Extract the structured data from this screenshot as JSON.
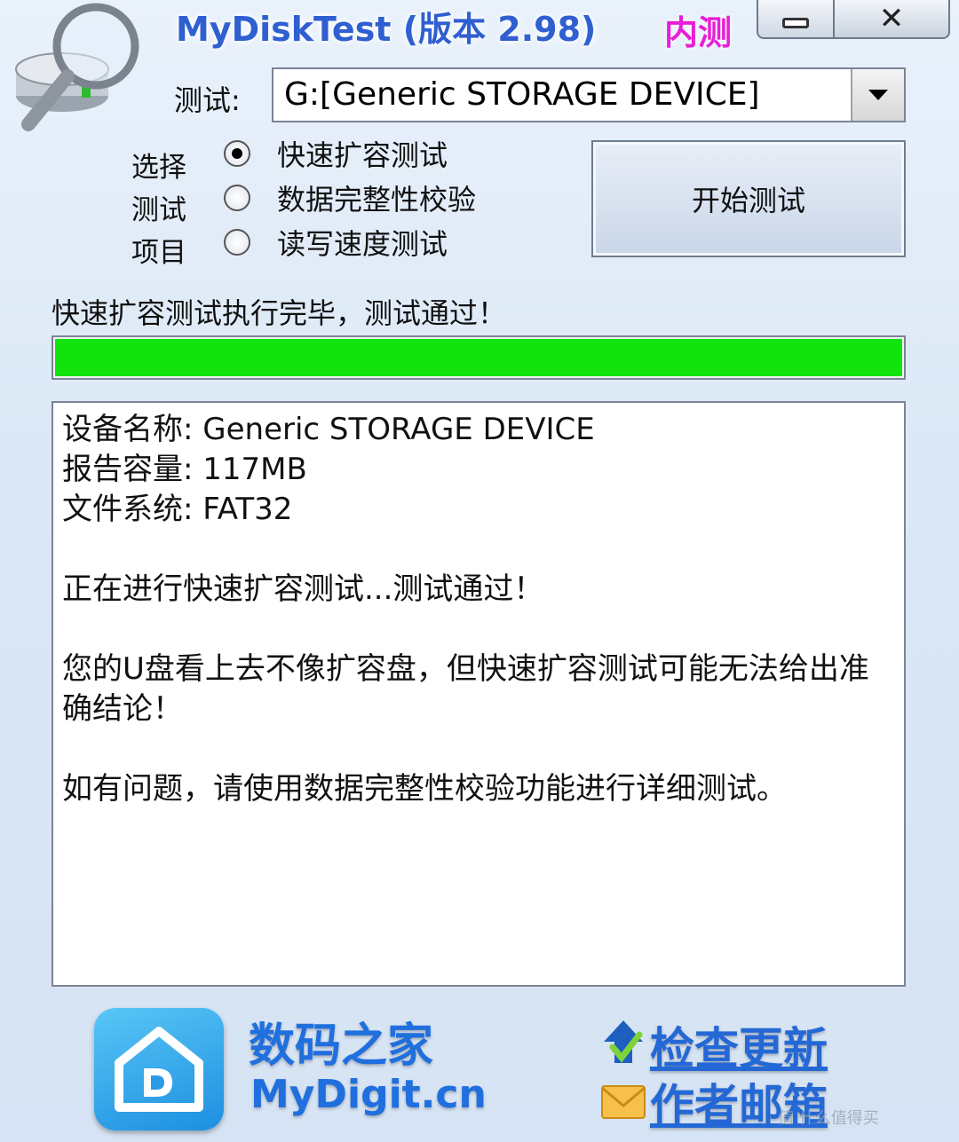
{
  "window": {
    "title": "MyDiskTest (版本 2.98)",
    "badge": "内测",
    "controls": [
      "minimize",
      "close"
    ]
  },
  "test_select": {
    "label": "测试:",
    "value": "G:[Generic STORAGE DEVICE]"
  },
  "options": {
    "group_label": [
      "选择",
      "测试",
      "项目"
    ],
    "items": [
      {
        "label": "快速扩容测试",
        "checked": true
      },
      {
        "label": "数据完整性校验",
        "checked": false
      },
      {
        "label": "读写速度测试",
        "checked": false
      }
    ]
  },
  "start_button": {
    "label": "开始测试"
  },
  "status": {
    "text": "快速扩容测试执行完毕，测试通过！",
    "progress": 1.0,
    "progress_color": "#12e30d"
  },
  "log": {
    "device_name": "设备名称: Generic STORAGE DEVICE",
    "capacity": "报告容量: 117MB",
    "filesystem": "文件系统: FAT32",
    "progress_msg": "正在进行快速扩容测试...测试通过！",
    "note": "您的U盘看上去不像扩容盘，但快速扩容测试可能无法给出准确结论！",
    "advice": "如有问题，请使用数据完整性校验功能进行详细测试。"
  },
  "footer": {
    "brand_name": "数码之家",
    "brand_url": "MyDigit.cn",
    "check_update": "检查更新",
    "author_email": "作者邮箱"
  },
  "colors": {
    "accent": "#2f5fd0",
    "badge": "#e81ed6",
    "link": "#2468d6"
  },
  "watermark": "值 什么值得买"
}
